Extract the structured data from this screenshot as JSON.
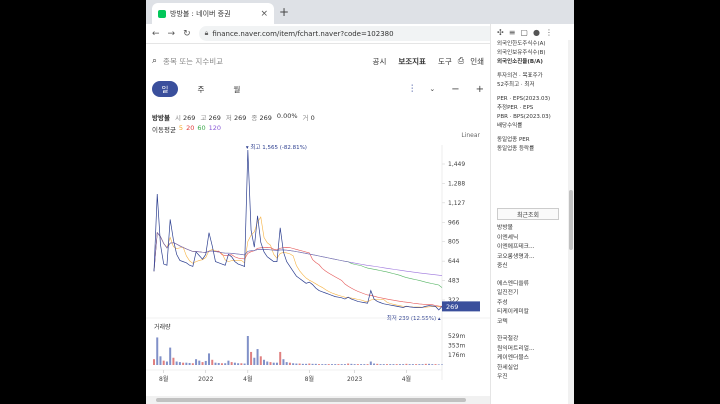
{
  "tab": {
    "title": "방방볼 : 네이버 증권"
  },
  "address": {
    "url": "finance.naver.com/item/fchart.naver?code=102380"
  },
  "search": {
    "placeholder": "종목 또는 지수비교",
    "menu": [
      "공시",
      "보조지표",
      "도구",
      "인쇄"
    ]
  },
  "period_tabs": [
    "일",
    "주",
    "월"
  ],
  "ohlc": {
    "name": "방방볼",
    "open_k": "시",
    "open": "269",
    "high_k": "고",
    "high": "269",
    "low_k": "저",
    "low": "269",
    "close_k": "종",
    "close": "269",
    "change": "0.00%",
    "vol_k": "거",
    "vol": "0"
  },
  "ma": {
    "label": "이동평균",
    "periods": [
      "5",
      "20",
      "60",
      "120"
    ],
    "colors": [
      "#f5a623",
      "#e03a3a",
      "#3aa84a",
      "#8a5bd6"
    ]
  },
  "scale_label": "Linear",
  "volume_label": "거래량",
  "colors": {
    "price": "#2c3e8f",
    "current": "#3a4f9c",
    "accent": "#e03a3a"
  },
  "chart_data": {
    "type": "line",
    "price_axis": [
      "1,449",
      "1,288",
      "1,127",
      "966",
      "805",
      "644",
      "483",
      "322"
    ],
    "current_price": "269",
    "high_annotation": "최고 1,565 (-82.81%)",
    "low_annotation": "최저 239 (12.55%)",
    "volume_axis": [
      "529m",
      "353m",
      "176m"
    ],
    "x_labels": [
      "8월",
      "2022",
      "4월",
      "8월",
      "2023",
      "4월"
    ],
    "ylim": [
      239,
      1565
    ],
    "series": [
      {
        "values": [
          560,
          1200,
          780,
          620,
          610,
          990,
          820,
          700,
          650,
          640,
          630,
          610,
          600,
          720,
          690,
          660,
          700,
          880,
          770,
          640,
          630,
          620,
          610,
          700,
          680,
          640,
          620,
          610,
          600,
          1565,
          900,
          760,
          1020,
          800,
          720,
          680,
          660,
          640,
          640,
          920,
          720,
          640,
          600,
          560,
          520,
          500,
          480,
          460,
          470,
          450,
          420,
          400,
          390,
          380,
          370,
          360,
          350,
          345,
          340,
          330,
          345,
          330,
          320,
          310,
          305,
          300,
          295,
          400,
          330,
          310,
          300,
          290,
          285,
          280,
          275,
          270,
          265,
          260,
          270,
          265,
          262,
          260,
          258,
          262,
          270,
          275,
          272,
          269,
          239,
          269
        ]
      }
    ],
    "volume": [
      20,
      95,
      30,
      15,
      12,
      60,
      25,
      12,
      10,
      8,
      8,
      7,
      6,
      20,
      15,
      10,
      14,
      40,
      18,
      8,
      7,
      6,
      6,
      15,
      10,
      8,
      6,
      6,
      5,
      100,
      45,
      25,
      55,
      30,
      18,
      12,
      10,
      8,
      8,
      45,
      20,
      10,
      8,
      6,
      5,
      5,
      4,
      4,
      5,
      4,
      4,
      3,
      3,
      3,
      3,
      3,
      3,
      3,
      3,
      3,
      5,
      4,
      3,
      3,
      3,
      3,
      3,
      12,
      5,
      4,
      3,
      3,
      3,
      3,
      3,
      3,
      3,
      3,
      4,
      3,
      3,
      3,
      3,
      3,
      4,
      4,
      3,
      3,
      2,
      2
    ]
  },
  "sidebar": {
    "info": [
      "외국인한도주식수(A)",
      "외국인보유주식수(B)",
      "외국인소진율(B/A)",
      "",
      "투자의견 · 목표주가",
      "52주최고 · 최저",
      "",
      "PER · EPS(2023.03)",
      "추정PER · EPS",
      "PBR · BPS(2023.03)",
      "배당수익률",
      "",
      "동일업종 PER",
      "동일업종 등락률"
    ],
    "recent_title": "최근조회",
    "recent": [
      "방방볼",
      "이엔셰닉",
      "이엔에프테크...",
      "코오롱생명과...",
      "중신",
      "",
      "에스엔디쓸류",
      "일진전기",
      "주성",
      "티케이케미칼",
      "코텍",
      "",
      "한국철강",
      "원익머트리얼...",
      "케이엔더블스",
      "한세실업",
      "우진"
    ]
  }
}
